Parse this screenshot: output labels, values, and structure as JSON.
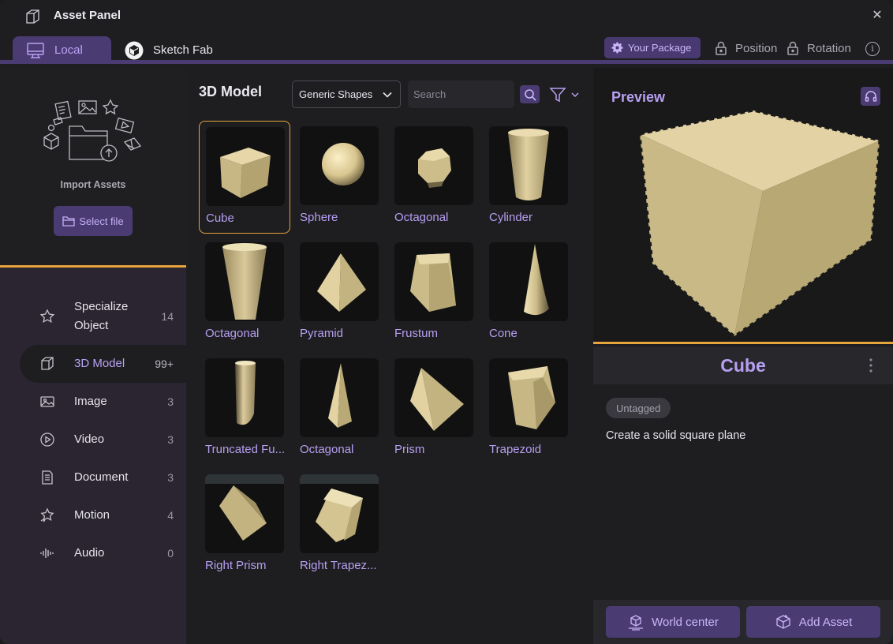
{
  "window": {
    "title": "Asset Panel",
    "close_label": "✕"
  },
  "tabs": [
    {
      "label": "Local",
      "icon": "monitor-icon",
      "active": true
    },
    {
      "label": "Sketch Fab",
      "icon": "sketchfab-icon",
      "active": false
    }
  ],
  "toolbar": {
    "package_label": "Your Package",
    "position_label": "Position",
    "rotation_label": "Rotation",
    "info_label": "i"
  },
  "import": {
    "label": "Import Assets",
    "select_file_label": "Select file"
  },
  "categories": [
    {
      "label": "Specialize Object",
      "count": "14",
      "icon": "star-icon"
    },
    {
      "label": "3D Model",
      "count": "99+",
      "icon": "cube-icon",
      "active": true
    },
    {
      "label": "Image",
      "count": "3",
      "icon": "image-icon"
    },
    {
      "label": "Video",
      "count": "3",
      "icon": "play-circle-icon"
    },
    {
      "label": "Document",
      "count": "3",
      "icon": "document-icon"
    },
    {
      "label": "Motion",
      "count": "4",
      "icon": "motion-star-icon"
    },
    {
      "label": "Audio",
      "count": "0",
      "icon": "waveform-icon"
    }
  ],
  "middle": {
    "title": "3D Model",
    "dropdown_value": "Generic Shapes",
    "search_placeholder": "Search"
  },
  "models": [
    {
      "name": "Cube",
      "shape": "cube",
      "selected": true
    },
    {
      "name": "Sphere",
      "shape": "sphere"
    },
    {
      "name": "Octagonal",
      "shape": "octagonal-ball"
    },
    {
      "name": "Cylinder",
      "shape": "cylinder"
    },
    {
      "name": "Octagonal",
      "shape": "octagonal-prism"
    },
    {
      "name": "Pyramid",
      "shape": "pyramid"
    },
    {
      "name": "Frustum",
      "shape": "frustum"
    },
    {
      "name": "Cone",
      "shape": "cone"
    },
    {
      "name": "Truncated Fu...",
      "shape": "truncated"
    },
    {
      "name": "Octagonal",
      "shape": "octagonal-cone"
    },
    {
      "name": "Prism",
      "shape": "prism"
    },
    {
      "name": "Trapezoid",
      "shape": "trapezoid"
    },
    {
      "name": "Right Prism",
      "shape": "right-prism"
    },
    {
      "name": "Right Trapez...",
      "shape": "right-trapezoid"
    }
  ],
  "preview": {
    "title": "Preview",
    "model_name": "Cube",
    "tag": "Untagged",
    "description": "Create a solid square plane"
  },
  "actions": {
    "world_center_label": "World center",
    "add_asset_label": "Add Asset"
  },
  "colors": {
    "accent_purple": "#b79ff1",
    "button_purple": "#4a3c73",
    "highlight_orange": "#e7a33c",
    "model_beige": "#d9c99b"
  }
}
